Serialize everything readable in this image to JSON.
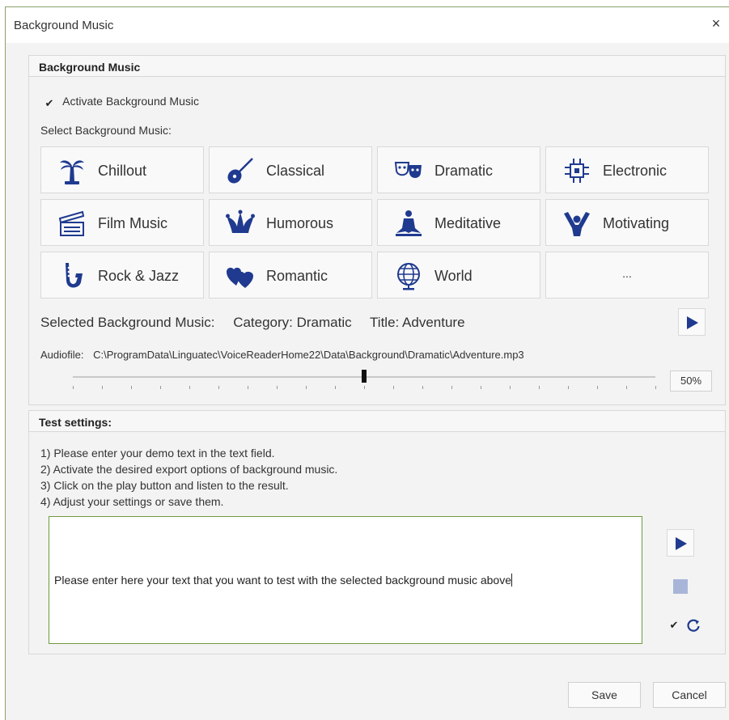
{
  "window": {
    "title": "Background Music",
    "close_label": "×"
  },
  "music_group": {
    "header": "Background Music",
    "activate_label": "Activate Background Music",
    "activate_checked": "✔",
    "select_label": "Select Background Music:",
    "categories": [
      {
        "label": "Chillout",
        "icon": "palm-tree-icon"
      },
      {
        "label": "Classical",
        "icon": "guitar-icon"
      },
      {
        "label": "Dramatic",
        "icon": "theater-masks-icon"
      },
      {
        "label": "Electronic",
        "icon": "circuit-chip-icon"
      },
      {
        "label": "Film Music",
        "icon": "clapperboard-icon"
      },
      {
        "label": "Humorous",
        "icon": "jester-hat-icon"
      },
      {
        "label": "Meditative",
        "icon": "meditation-icon"
      },
      {
        "label": "Motivating",
        "icon": "cheering-person-icon"
      },
      {
        "label": "Rock & Jazz",
        "icon": "saxophone-icon"
      },
      {
        "label": "Romantic",
        "icon": "hearts-icon"
      },
      {
        "label": "World",
        "icon": "globe-icon"
      },
      {
        "label": "...",
        "icon": ""
      }
    ],
    "selected": {
      "label": "Selected Background Music:",
      "category": "Category: Dramatic",
      "title": "Title: Adventure"
    },
    "audiofile_label": "Audiofile:",
    "audiofile_path": "C:\\ProgramData\\Linguatec\\VoiceReaderHome22\\Data\\Background\\Dramatic\\Adventure.mp3",
    "volume_percent": "50%",
    "volume_value": 0.5
  },
  "test_group": {
    "header": "Test settings:",
    "steps": [
      "1) Please enter your demo text in the text field.",
      "2) Activate the desired export options of background music.",
      "3) Click on the play button and listen to the result.",
      "4) Adjust your settings or save them."
    ],
    "text_value": "Please enter here your text that you want to test with the selected background music above",
    "loop_checked": "✔"
  },
  "footer": {
    "save_label": "Save",
    "cancel_label": "Cancel"
  },
  "colors": {
    "accent": "#1f3a8f",
    "border_green": "#6f9a3f",
    "stop_disabled": "#a9b5d8"
  }
}
